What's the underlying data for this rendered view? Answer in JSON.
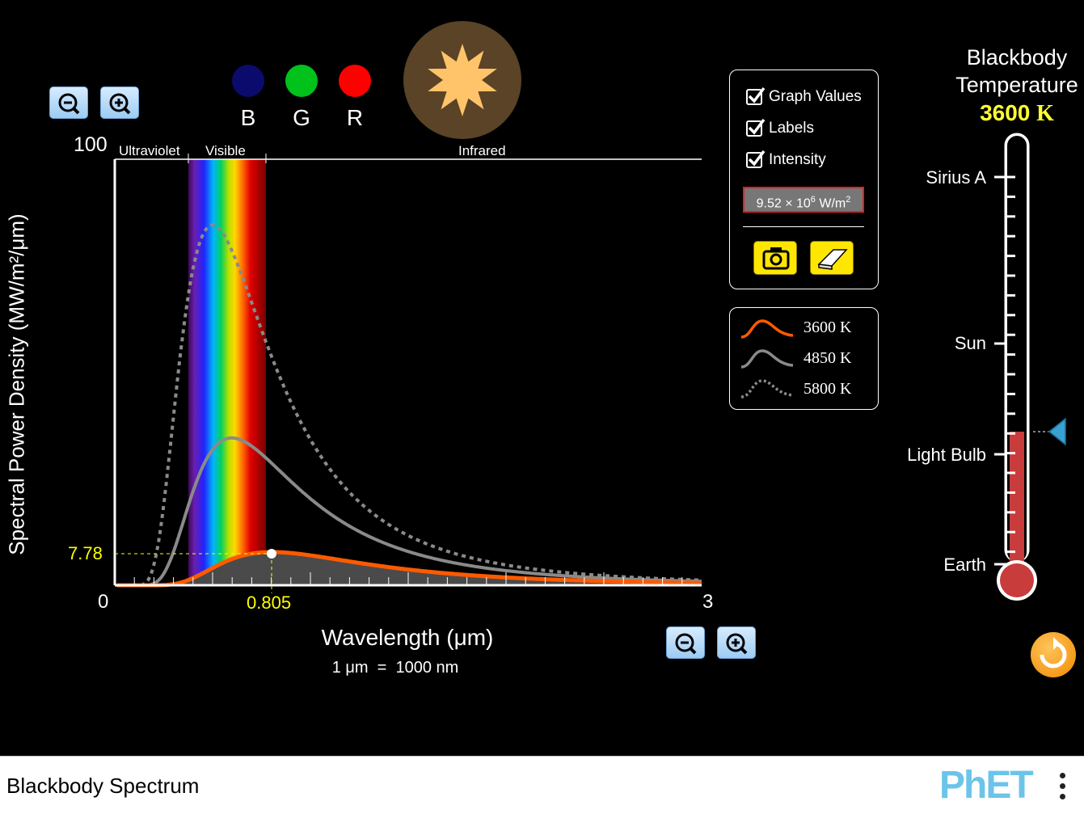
{
  "app": {
    "title": "Blackbody Spectrum",
    "logo_text": "PhET"
  },
  "color_sensors": [
    {
      "label": "B",
      "color": "#0b0b6e"
    },
    {
      "label": "G",
      "color": "#00c21a"
    },
    {
      "label": "R",
      "color": "#ff0000"
    }
  ],
  "star": {
    "color": "#ffc46a",
    "bg": "#5a4326",
    "icon": "star-icon"
  },
  "graph": {
    "y_max_label": "100",
    "y_min_label": "0",
    "x_max_label": "3",
    "y_axis_title": "Spectral Power Density (MW/m²/μm)",
    "x_axis_title": "Wavelength (μm)",
    "x_unit_note": "1 μm  =  1000 nm",
    "regions": {
      "uv": "Ultraviolet",
      "visible": "Visible",
      "ir": "Infrared"
    },
    "peak_value_label": "7.78",
    "peak_wavelength_label": "0.805"
  },
  "options": {
    "graph_values": {
      "label": "Graph Values",
      "checked": true
    },
    "labels": {
      "label": "Labels",
      "checked": true
    },
    "intensity": {
      "label": "Intensity",
      "checked": true
    },
    "intensity_value": "9.52 × 10",
    "intensity_exp": "6",
    "intensity_unit": " W/m",
    "intensity_unit_exp": "2"
  },
  "legend": [
    {
      "label": "3600 K",
      "color": "#ff5a00",
      "style": "solid"
    },
    {
      "label": "4850 K",
      "color": "#8a8a8a",
      "style": "solid"
    },
    {
      "label": "5800 K",
      "color": "#8a8a8a",
      "style": "dotted"
    }
  ],
  "thermometer": {
    "title_line1": "Blackbody",
    "title_line2": "Temperature",
    "temperature_value": "3600",
    "temperature_unit": "K",
    "markers": [
      "Sirius A",
      "Sun",
      "Light Bulb",
      "Earth"
    ],
    "fill_color": "#c83c3c"
  },
  "chart_data": {
    "type": "line",
    "x_range": [
      0,
      3
    ],
    "y_range": [
      0,
      100
    ],
    "xlabel": "Wavelength (μm)",
    "ylabel": "Spectral Power Density (MW/m²/μm)",
    "series": [
      {
        "name": "3600 K",
        "temperature": 3600,
        "color": "#ff5a00",
        "dash": "solid",
        "peak": {
          "x": 0.805,
          "y": 7.78
        }
      },
      {
        "name": "4850 K",
        "temperature": 4850,
        "color": "#8a8a8a",
        "dash": "solid"
      },
      {
        "name": "5800 K",
        "temperature": 5800,
        "color": "#8a8a8a",
        "dash": "dotted"
      }
    ]
  }
}
